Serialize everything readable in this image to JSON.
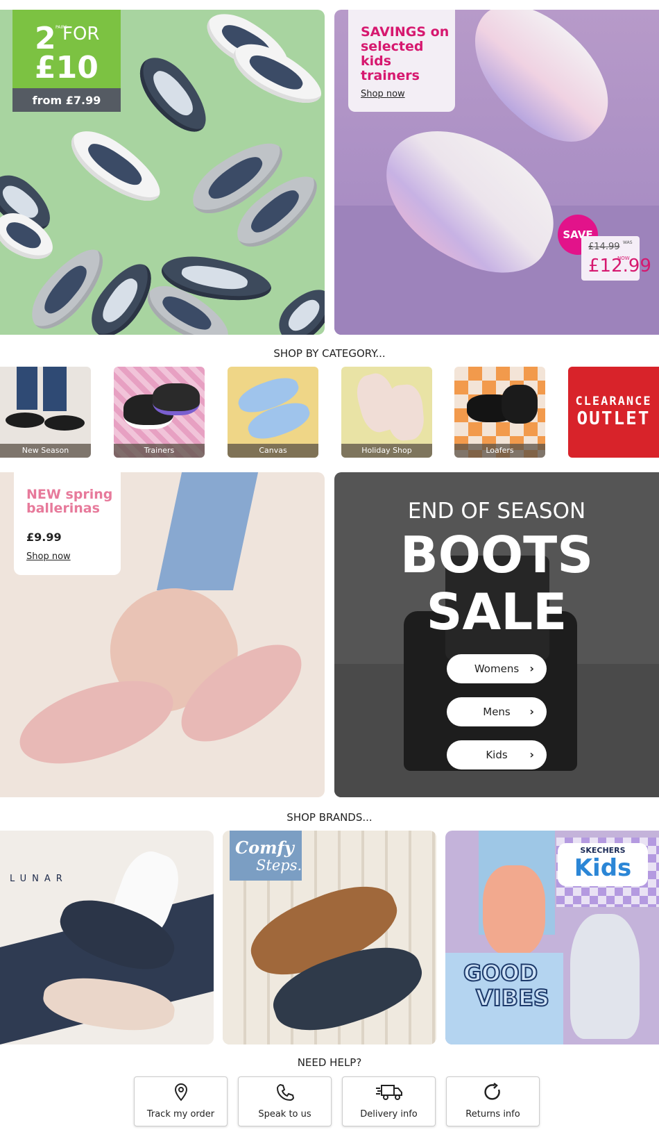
{
  "hero_left": {
    "promo_number": "2",
    "promo_pairs": "PAIRS",
    "promo_for": "FOR",
    "promo_price": "£10",
    "promo_from": "from £7.99"
  },
  "hero_right": {
    "title": "SAVINGS on selected kids trainers",
    "link": "Shop now",
    "save_badge": "SAVE",
    "was_label": "WAS",
    "was_price": "£14.99",
    "now_label": "NOW",
    "now_price": "£12.99"
  },
  "categories": {
    "heading": "SHOP BY CATEGORY...",
    "items": [
      {
        "label": "New Season"
      },
      {
        "label": "Trainers"
      },
      {
        "label": "Canvas"
      },
      {
        "label": "Holiday Shop"
      },
      {
        "label": "Loafers"
      }
    ],
    "clearance_line1": "CLEARANCE",
    "clearance_line2": "OUTLET"
  },
  "ballerinas": {
    "title": "NEW spring ballerinas",
    "price": "£9.99",
    "link": "Shop now"
  },
  "boots": {
    "eyebrow": "END OF SEASON",
    "line1": "BOOTS",
    "line2": "SALE",
    "buttons": [
      {
        "label": "Womens"
      },
      {
        "label": "Mens"
      },
      {
        "label": "Kids"
      }
    ]
  },
  "brands": {
    "heading": "SHOP BRANDS...",
    "lunar": "LUNAR",
    "comfy_line1": "Comfy",
    "comfy_line2": "Steps.",
    "skechers": "SKECHERS",
    "kids": "Kids",
    "good": "GOOD",
    "vibes": "VIBES"
  },
  "help": {
    "heading": "NEED HELP?",
    "items": [
      {
        "label": "Track my order",
        "icon": "location-pin-icon"
      },
      {
        "label": "Speak to us",
        "icon": "phone-icon"
      },
      {
        "label": "Delivery info",
        "icon": "truck-icon"
      },
      {
        "label": "Returns info",
        "icon": "return-icon"
      }
    ]
  },
  "colors": {
    "accent_pink": "#d6186f",
    "save_pink": "#e2138a",
    "promo_green": "#7cc242",
    "clearance_red": "#d8232a"
  }
}
